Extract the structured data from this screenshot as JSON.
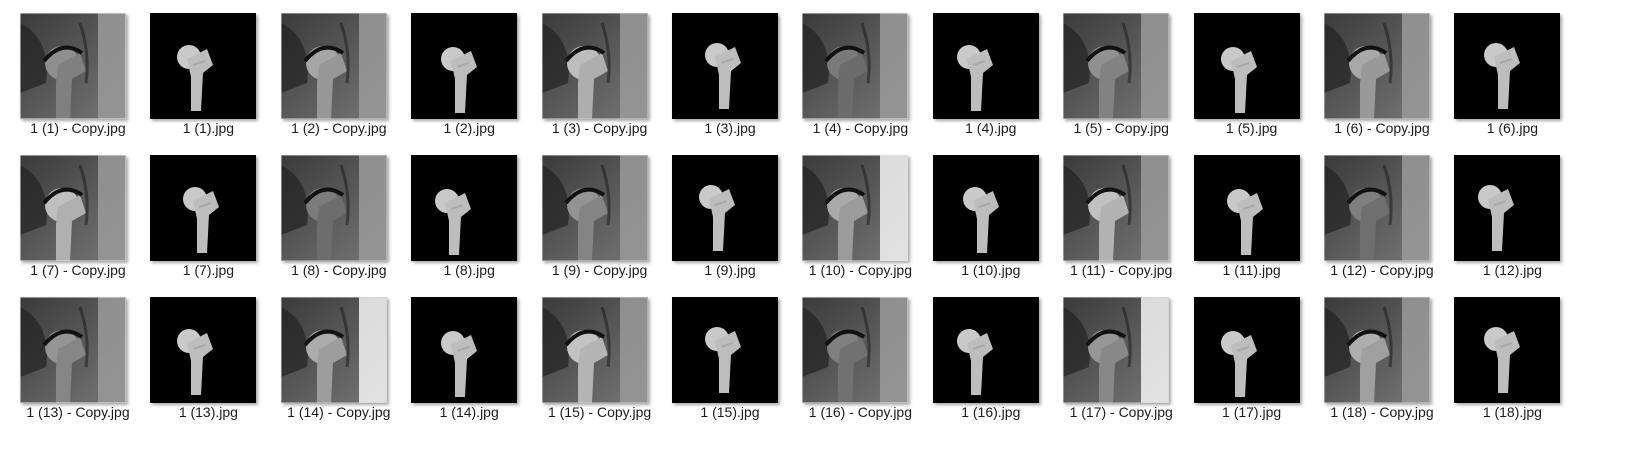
{
  "files": [
    {
      "name": "1 (1) - Copy.jpg",
      "kind": "mri",
      "variant": 1
    },
    {
      "name": "1 (1).jpg",
      "kind": "mask",
      "variant": 1
    },
    {
      "name": "1 (2) - Copy.jpg",
      "kind": "mri",
      "variant": 2
    },
    {
      "name": "1 (2).jpg",
      "kind": "mask",
      "variant": 2
    },
    {
      "name": "1 (3) - Copy.jpg",
      "kind": "mri",
      "variant": 3
    },
    {
      "name": "1 (3).jpg",
      "kind": "mask",
      "variant": 3
    },
    {
      "name": "1 (4) - Copy.jpg",
      "kind": "mri",
      "variant": 4
    },
    {
      "name": "1 (4).jpg",
      "kind": "mask",
      "variant": 4
    },
    {
      "name": "1 (5) - Copy.jpg",
      "kind": "mri",
      "variant": 5
    },
    {
      "name": "1 (5).jpg",
      "kind": "mask",
      "variant": 5
    },
    {
      "name": "1 (6) - Copy.jpg",
      "kind": "mri",
      "variant": 6
    },
    {
      "name": "1 (6).jpg",
      "kind": "mask",
      "variant": 6
    },
    {
      "name": "1 (7) - Copy.jpg",
      "kind": "mri",
      "variant": 7
    },
    {
      "name": "1 (7).jpg",
      "kind": "mask",
      "variant": 7
    },
    {
      "name": "1 (8) - Copy.jpg",
      "kind": "mri",
      "variant": 8
    },
    {
      "name": "1 (8).jpg",
      "kind": "mask",
      "variant": 8
    },
    {
      "name": "1 (9) - Copy.jpg",
      "kind": "mri",
      "variant": 9
    },
    {
      "name": "1 (9).jpg",
      "kind": "mask",
      "variant": 9
    },
    {
      "name": "1 (10) - Copy.jpg",
      "kind": "mri",
      "variant": 10
    },
    {
      "name": "1 (10).jpg",
      "kind": "mask",
      "variant": 10
    },
    {
      "name": "1 (11) - Copy.jpg",
      "kind": "mri",
      "variant": 11
    },
    {
      "name": "1 (11).jpg",
      "kind": "mask",
      "variant": 11
    },
    {
      "name": "1 (12) - Copy.jpg",
      "kind": "mri",
      "variant": 12
    },
    {
      "name": "1 (12).jpg",
      "kind": "mask",
      "variant": 12
    },
    {
      "name": "1 (13) - Copy.jpg",
      "kind": "mri",
      "variant": 13
    },
    {
      "name": "1 (13).jpg",
      "kind": "mask",
      "variant": 13
    },
    {
      "name": "1 (14) - Copy.jpg",
      "kind": "mri",
      "variant": 14
    },
    {
      "name": "1 (14).jpg",
      "kind": "mask",
      "variant": 14
    },
    {
      "name": "1 (15) - Copy.jpg",
      "kind": "mri",
      "variant": 15
    },
    {
      "name": "1 (15).jpg",
      "kind": "mask",
      "variant": 15
    },
    {
      "name": "1 (16) - Copy.jpg",
      "kind": "mri",
      "variant": 16
    },
    {
      "name": "1 (16).jpg",
      "kind": "mask",
      "variant": 16
    },
    {
      "name": "1 (17) - Copy.jpg",
      "kind": "mri",
      "variant": 17
    },
    {
      "name": "1 (17).jpg",
      "kind": "mask",
      "variant": 17
    },
    {
      "name": "1 (18) - Copy.jpg",
      "kind": "mri",
      "variant": 18
    },
    {
      "name": "1 (18).jpg",
      "kind": "mask",
      "variant": 18
    }
  ]
}
